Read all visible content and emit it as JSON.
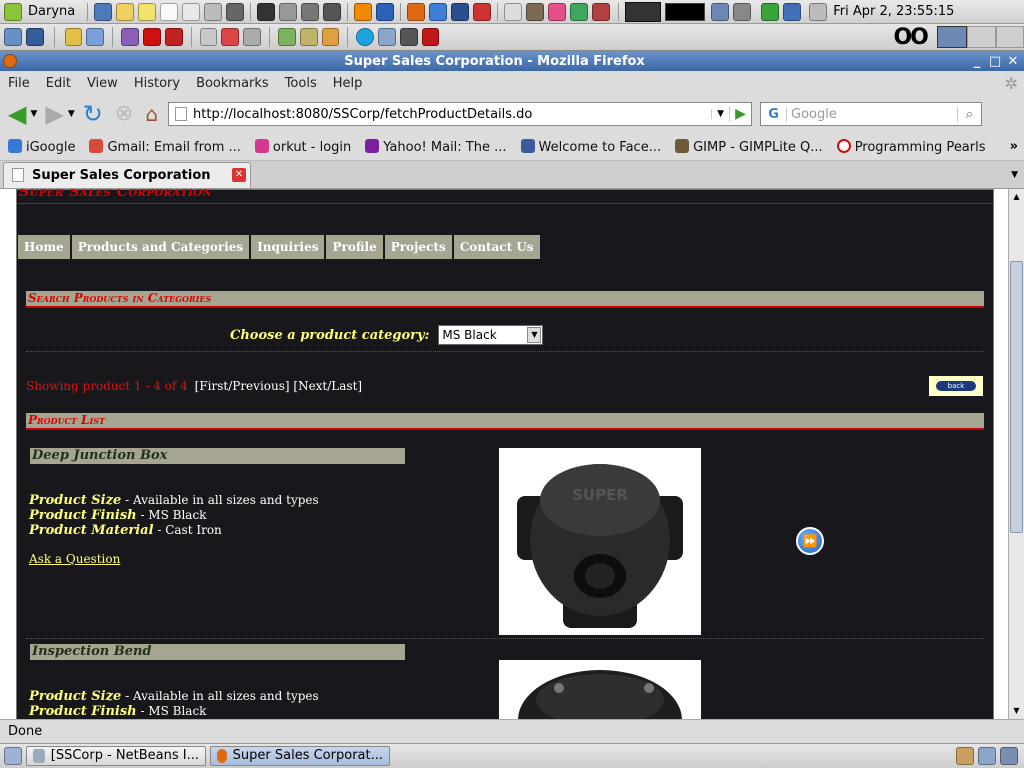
{
  "panel": {
    "user": "Daryna",
    "clock": "Fri Apr  2, 23:55:15"
  },
  "window": {
    "title": "Super Sales Corporation - Mozilla Firefox"
  },
  "menu": [
    "File",
    "Edit",
    "View",
    "History",
    "Bookmarks",
    "Tools",
    "Help"
  ],
  "nav": {
    "url": "http://localhost:8080/SSCorp/fetchProductDetails.do",
    "search_placeholder": "Google"
  },
  "bookmarks": [
    {
      "label": "iGoogle",
      "color": "#3a78d8"
    },
    {
      "label": "Gmail: Email from ...",
      "color": "#d84a3a"
    },
    {
      "label": "orkut - login",
      "color": "#d23a8f"
    },
    {
      "label": "Yahoo! Mail: The ...",
      "color": "#7b1fa2"
    },
    {
      "label": "Welcome to Face...",
      "color": "#3b5998"
    },
    {
      "label": "GIMP - GIMPLite Q...",
      "color": "#6b5a3a"
    },
    {
      "label": "Programming Pearls",
      "color": "#d01010"
    }
  ],
  "tab": {
    "title": "Super Sales Corporation"
  },
  "site": {
    "header": "Super Sales Corporation",
    "nav": [
      "Home",
      "Products and Categories",
      "Inquiries",
      "Profile",
      "Projects",
      "Contact Us"
    ],
    "search_title": "Search Products in Categories",
    "category_label": "Choose a product category:",
    "category_value": "MS Black",
    "showing": "Showing product 1 - 4 of 4",
    "pager": "[First/Previous] [Next/Last]",
    "back_label": "back",
    "list_title": "Product List",
    "products": [
      {
        "name": "Deep Junction Box",
        "size_label": "Product Size",
        "size": " - Available in all sizes and types",
        "finish_label": "Product Finish",
        "finish": " - MS Black",
        "material_label": "Product Material",
        "material": " - Cast Iron",
        "ask": "Ask a Question",
        "emboss": "SUPER"
      },
      {
        "name": "Inspection Bend",
        "size_label": "Product Size",
        "size": " - Available in all sizes and types",
        "finish_label": "Product Finish",
        "finish": " - MS Black"
      }
    ]
  },
  "status": {
    "text": "Done"
  },
  "taskbar": [
    {
      "label": "[SSCorp - NetBeans I..."
    },
    {
      "label": "Super Sales Corporat..."
    }
  ]
}
